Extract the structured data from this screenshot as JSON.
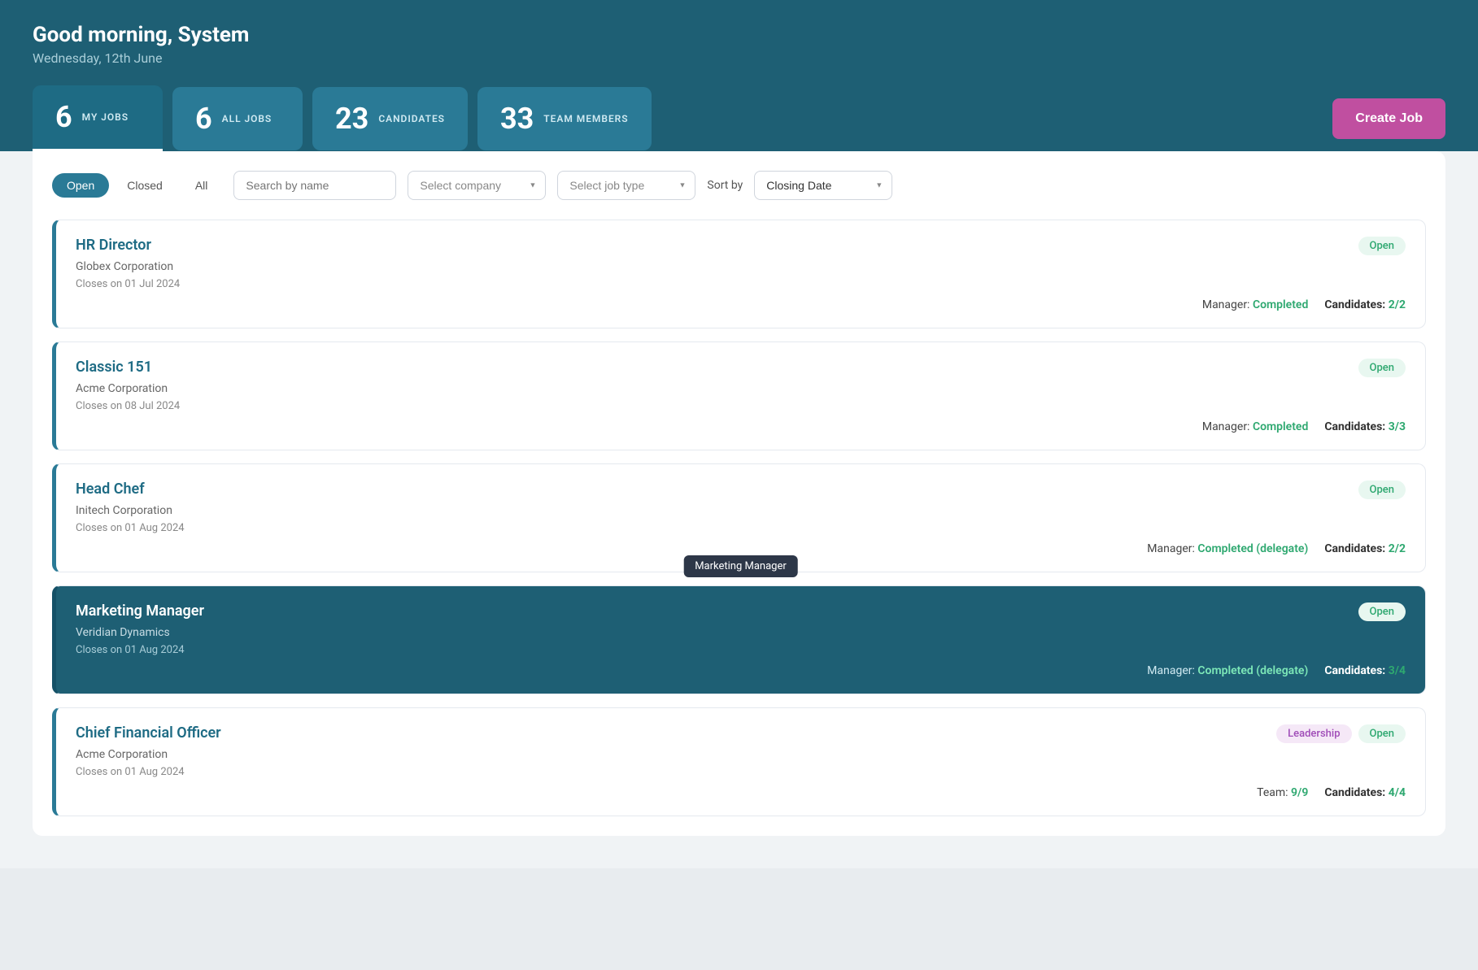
{
  "header": {
    "greeting": "Good morning, System",
    "date": "Wednesday, 12th June"
  },
  "stats": [
    {
      "id": "my-jobs",
      "number": "6",
      "label": "MY JOBS",
      "active": true
    },
    {
      "id": "all-jobs",
      "number": "6",
      "label": "ALL JOBS",
      "active": false
    },
    {
      "id": "candidates",
      "number": "23",
      "label": "CANDIDATES",
      "active": false
    },
    {
      "id": "team-members",
      "number": "33",
      "label": "TEAM MEMBERS",
      "active": false
    }
  ],
  "create_job_label": "Create Job",
  "tabs": [
    {
      "id": "open",
      "label": "Open",
      "active": true
    },
    {
      "id": "closed",
      "label": "Closed",
      "active": false
    },
    {
      "id": "all",
      "label": "All",
      "active": false
    }
  ],
  "filters": {
    "search_placeholder": "Search by name",
    "company_placeholder": "Select company",
    "job_type_placeholder": "Select job type",
    "sort_label": "Sort by",
    "sort_value": "Closing Date"
  },
  "jobs": [
    {
      "id": "hr-director",
      "title": "HR Director",
      "company": "Globex Corporation",
      "closes": "Closes on 01 Jul 2024",
      "status": "Open",
      "manager_label": "Manager:",
      "manager_status": "Completed",
      "manager_delegate": false,
      "candidates_label": "Candidates:",
      "candidates_value": "2/2",
      "tags": [],
      "highlighted": false,
      "tooltip": null
    },
    {
      "id": "classic-151",
      "title": "Classic 151",
      "company": "Acme Corporation",
      "closes": "Closes on 08 Jul 2024",
      "status": "Open",
      "manager_label": "Manager:",
      "manager_status": "Completed",
      "manager_delegate": false,
      "candidates_label": "Candidates:",
      "candidates_value": "3/3",
      "tags": [],
      "highlighted": false,
      "tooltip": null
    },
    {
      "id": "head-chef",
      "title": "Head Chef",
      "company": "Initech Corporation",
      "closes": "Closes on 01 Aug 2024",
      "status": "Open",
      "manager_label": "Manager:",
      "manager_status": "Completed (delegate)",
      "manager_delegate": true,
      "candidates_label": "Candidates:",
      "candidates_value": "2/2",
      "tags": [],
      "highlighted": false,
      "tooltip": null
    },
    {
      "id": "marketing-manager",
      "title": "Marketing Manager",
      "company": "Veridian Dynamics",
      "closes": "Closes on 01 Aug 2024",
      "status": "Open",
      "manager_label": "Manager:",
      "manager_status": "Completed (delegate)",
      "manager_delegate": true,
      "candidates_label": "Candidates:",
      "candidates_value": "3/4",
      "tags": [],
      "highlighted": true,
      "tooltip": "Marketing Manager"
    },
    {
      "id": "chief-financial-officer",
      "title": "Chief Financial Officer",
      "company": "Acme Corporation",
      "closes": "Closes on 01 Aug 2024",
      "status": "Open",
      "team_label": "Team:",
      "team_value": "9/9",
      "candidates_label": "Candidates:",
      "candidates_value": "4/4",
      "tags": [
        "Leadership"
      ],
      "highlighted": false,
      "tooltip": null
    }
  ]
}
